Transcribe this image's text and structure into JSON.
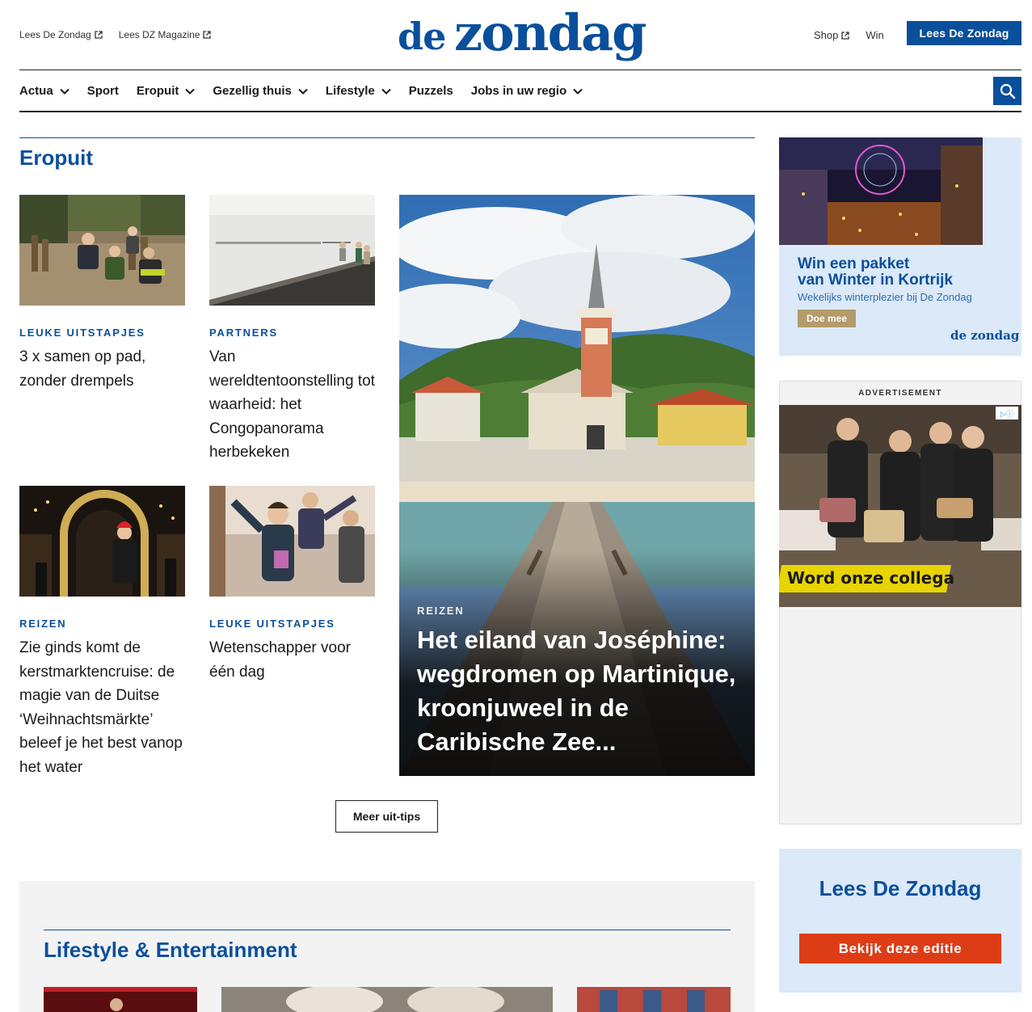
{
  "header": {
    "left_links": [
      "Lees De Zondag",
      "Lees DZ Magazine"
    ],
    "logo_de": "de",
    "logo_zondag": "zondag",
    "right_links": [
      "Shop",
      "Win"
    ],
    "cta_label": "Lees De Zondag"
  },
  "nav": {
    "items": [
      {
        "label": "Actua",
        "has_dropdown": true
      },
      {
        "label": "Sport",
        "has_dropdown": false
      },
      {
        "label": "Eropuit",
        "has_dropdown": true
      },
      {
        "label": "Gezellig thuis",
        "has_dropdown": true
      },
      {
        "label": "Lifestyle",
        "has_dropdown": true
      },
      {
        "label": "Puzzels",
        "has_dropdown": false
      },
      {
        "label": "Jobs in uw regio",
        "has_dropdown": true
      }
    ],
    "search_icon": "search-icon"
  },
  "eropuit": {
    "title": "Eropuit",
    "cards": [
      {
        "category": "LEUKE UITSTAPJES",
        "headline": "3 x samen op pad, zonder drempels"
      },
      {
        "category": "PARTNERS",
        "headline": "Van wereldtentoonstelling tot waarheid: het Congopanorama herbekeken"
      },
      {
        "category": "REIZEN",
        "headline": "Zie ginds komt de kerstmarktencruise: de magie van de Duitse ‘Weihnachtsmärkte’ beleef je het best vanop het water"
      },
      {
        "category": "LEUKE UITSTAPJES",
        "headline": "Wetenschapper voor één dag"
      }
    ],
    "featured": {
      "category": "REIZEN",
      "headline": "Het eiland van Joséphine: wegdromen op Martinique, kroonjuweel in de Caribische Zee..."
    },
    "more_button": "Meer uit-tips"
  },
  "lifestyle": {
    "title": "Lifestyle & Entertainment"
  },
  "sidebar": {
    "promo": {
      "title_line1": "Win een pakket",
      "title_line2": "van Winter in Kortrijk",
      "subtitle": "Wekelijks winterplezier bij De Zondag",
      "button": "Doe mee",
      "mini_logo": "de zondag"
    },
    "advert": {
      "label": "ADVERTISEMENT",
      "banner_text": "Word onze collega"
    },
    "read_box": {
      "title": "Lees De Zondag",
      "button": "Bekijk deze editie"
    }
  },
  "colors": {
    "brand_blue": "#0a4f9c",
    "cta_red": "#dc3d17",
    "light_blue_bg": "#dbe9f8",
    "gray_bg": "#f3f3f3"
  }
}
